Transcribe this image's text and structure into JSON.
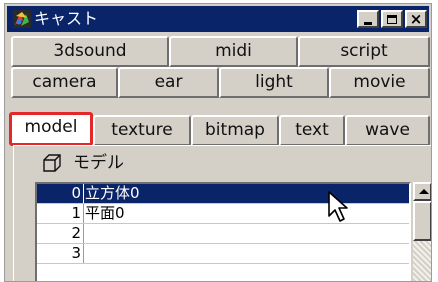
{
  "window": {
    "title": "キャスト",
    "app_icon": "cast-app-icon",
    "controls": {
      "minimize": "minimize-icon",
      "maximize": "maximize-icon",
      "close": "close-icon",
      "close_glyph": "×"
    }
  },
  "tabs": {
    "row1": [
      {
        "label": "3dsound"
      },
      {
        "label": "midi"
      },
      {
        "label": "script"
      }
    ],
    "row2": [
      {
        "label": "camera"
      },
      {
        "label": "ear"
      },
      {
        "label": "light"
      },
      {
        "label": "movie"
      }
    ],
    "row3": [
      {
        "label": "model"
      },
      {
        "label": "texture"
      },
      {
        "label": "bitmap"
      },
      {
        "label": "text"
      },
      {
        "label": "wave"
      }
    ],
    "active": "model"
  },
  "panel": {
    "title": "モデル",
    "icon": "cube-icon"
  },
  "list": {
    "rows": [
      {
        "index": "0",
        "name": "立方体0",
        "selected": true
      },
      {
        "index": "1",
        "name": "平面0",
        "selected": false
      },
      {
        "index": "2",
        "name": "",
        "selected": false
      },
      {
        "index": "3",
        "name": "",
        "selected": false
      }
    ]
  },
  "colors": {
    "titlebar": "#0a246a",
    "selection": "#0a246a",
    "active_tab_border": "#e22828",
    "face": "#d4d0c8"
  }
}
